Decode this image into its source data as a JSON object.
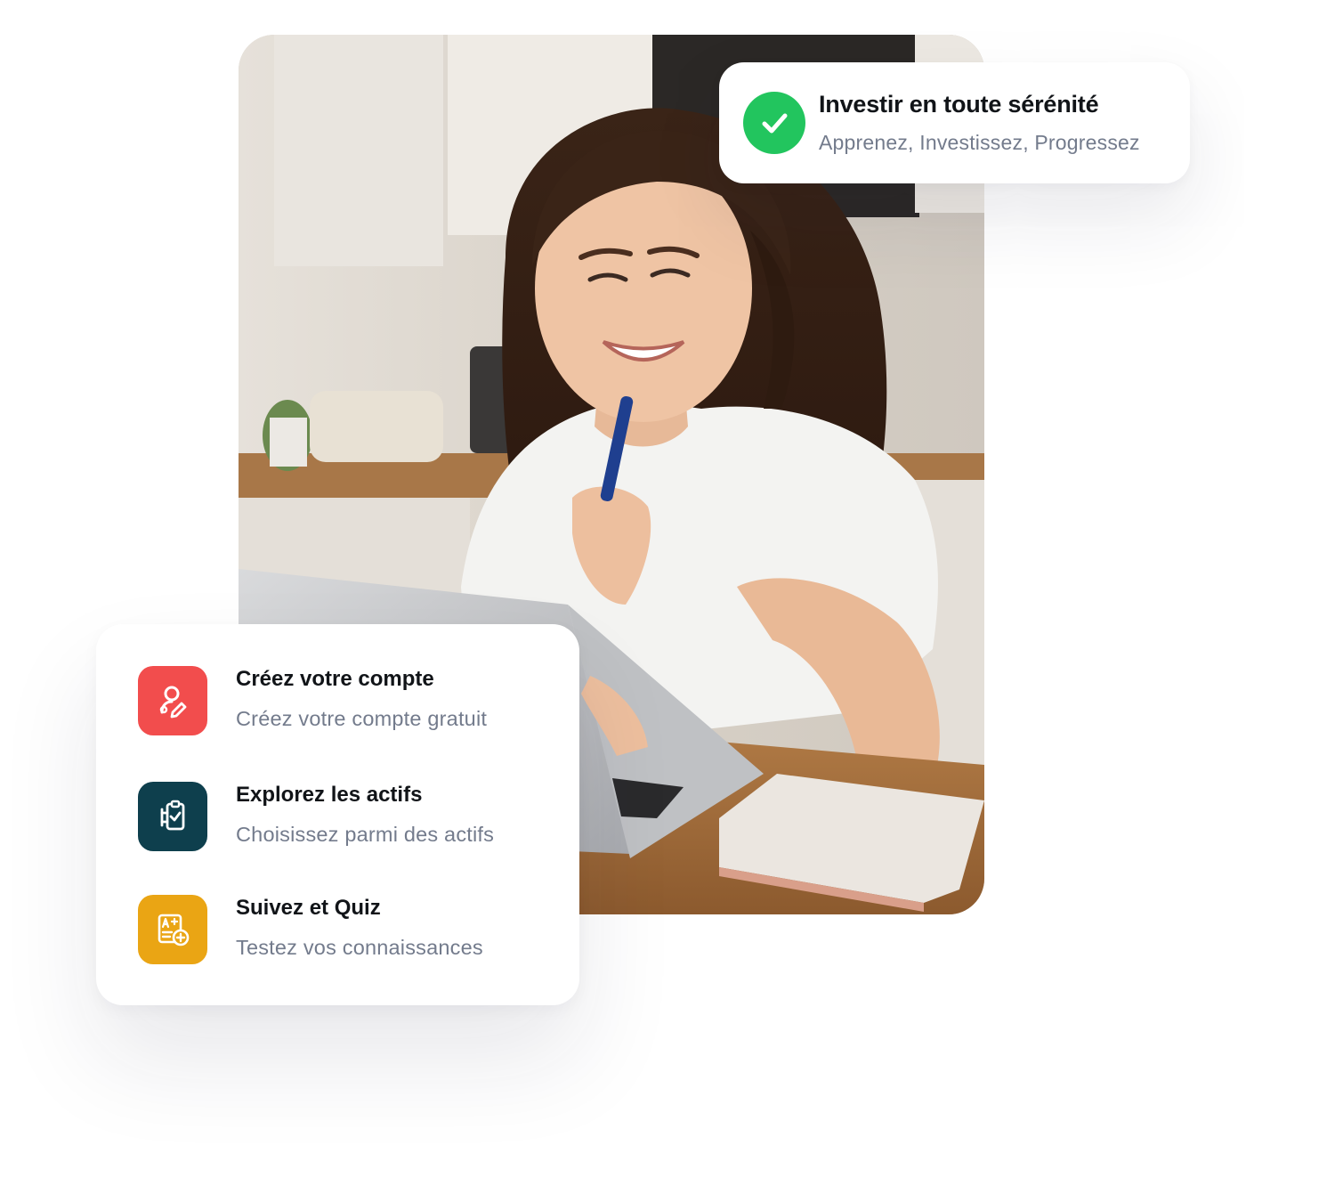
{
  "badge": {
    "icon": "check-circle-icon",
    "color": "#22c55e",
    "title": "Investir en toute sérénité",
    "subtitle": "Apprenez, Investissez, Progressez"
  },
  "photo": {
    "icon": "woman-laptop-photo"
  },
  "steps": [
    {
      "icon": "user-edit-icon",
      "color": "#f24d4d",
      "title": "Créez votre compte",
      "description": "Créez votre compte gratuit"
    },
    {
      "icon": "clipboard-check-icon",
      "color": "#0e3f4d",
      "title": "Explorez les actifs",
      "description": "Choisissez parmi des actifs"
    },
    {
      "icon": "grade-quiz-icon",
      "color": "#eaa514",
      "title": "Suivez et Quiz",
      "description": "Testez vos connaissances"
    }
  ]
}
